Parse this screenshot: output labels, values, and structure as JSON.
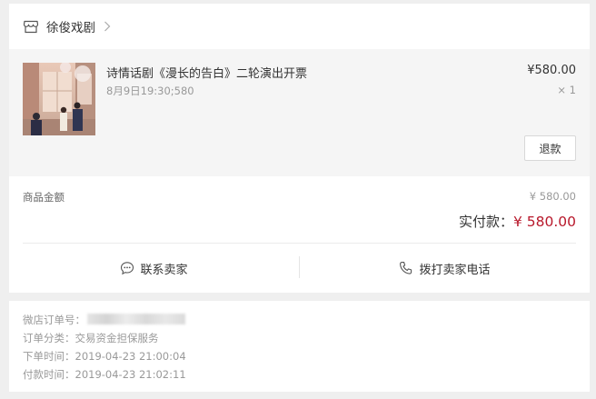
{
  "shop": {
    "name": "徐俊戏剧"
  },
  "product": {
    "title": "诗情话剧《漫长的告白》二轮演出开票",
    "spec": "8月9日19:30;580",
    "price": "¥580.00",
    "quantity": "× 1",
    "refund_label": "退款"
  },
  "summary": {
    "goods_amount_label": "商品金额",
    "goods_amount_value": "¥ 580.00",
    "paid_label": "实付款：",
    "paid_value": "¥ 580.00"
  },
  "actions": {
    "contact_seller_label": "联系卖家",
    "call_seller_label": "拨打卖家电话"
  },
  "order_info": {
    "order_no_label": "微店订单号：",
    "category": "订单分类：交易资金担保服务",
    "order_time": "下单时间：2019-04-23 21:00:04",
    "pay_time": "付款时间：2019-04-23 21:02:11"
  },
  "colors": {
    "page_bg": "#efefef",
    "product_bg": "#f5f5f5",
    "paid_accent": "#b8182b"
  },
  "icons": {
    "shop": "store-icon",
    "chevron": "chevron-right-icon",
    "chat": "chat-bubble-icon",
    "phone": "phone-icon"
  }
}
